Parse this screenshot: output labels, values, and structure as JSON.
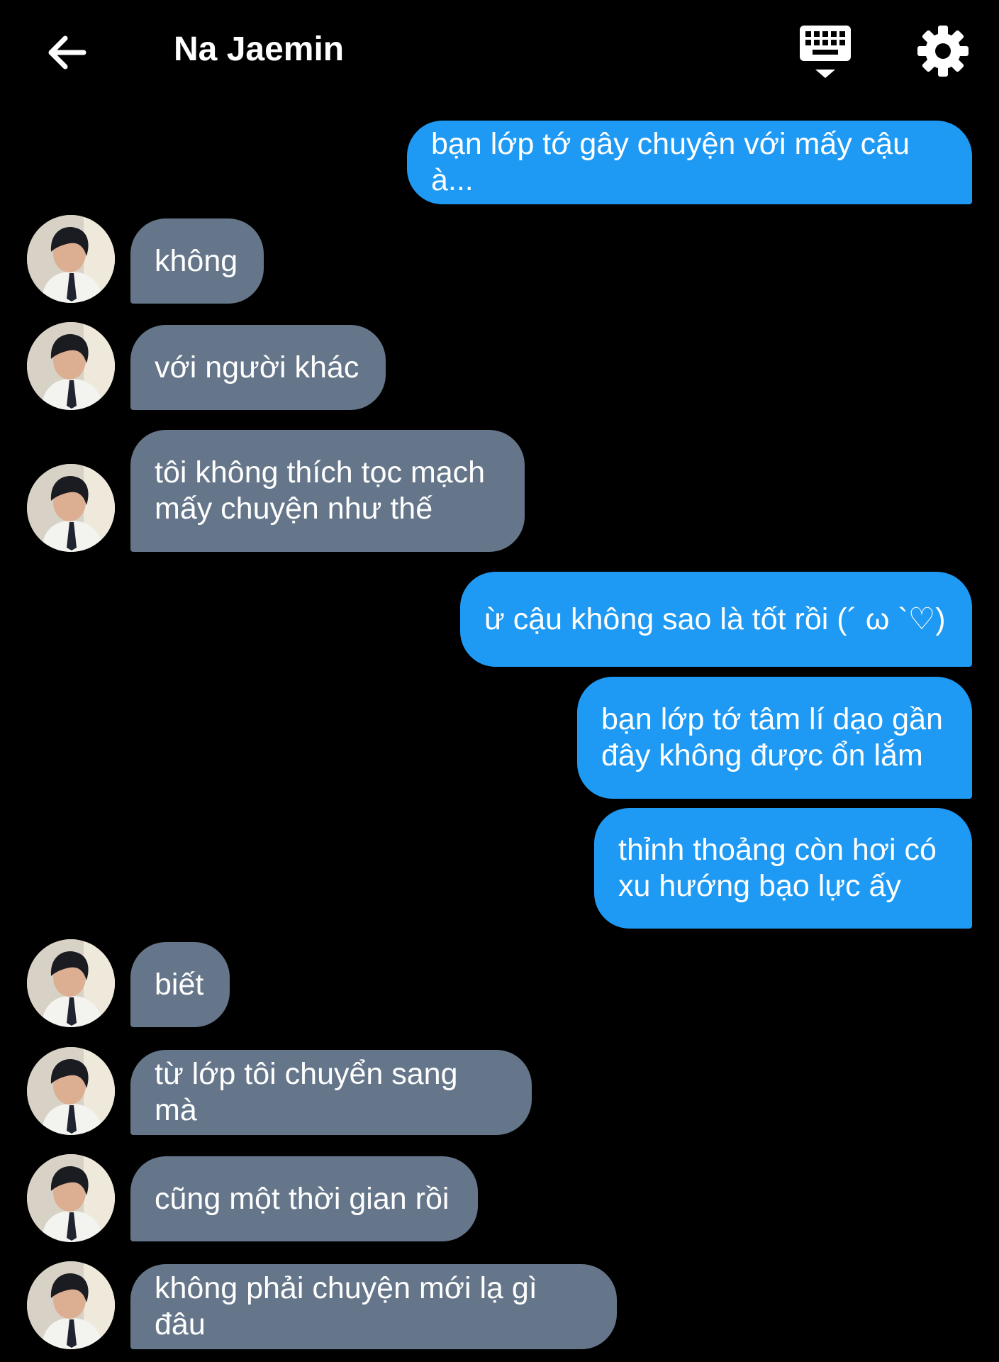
{
  "header": {
    "title": "Na Jaemin",
    "back_icon": "arrow-left-icon",
    "keyboard_icon": "keyboard-hide-icon",
    "settings_icon": "gear-icon"
  },
  "colors": {
    "background": "#000000",
    "sent_bubble": "#1e9af5",
    "received_bubble": "#65768a",
    "text": "#ffffff"
  },
  "messages": [
    {
      "from": "me",
      "text": "bạn lớp tớ gây chuyện với mấy cậu à..."
    },
    {
      "from": "them",
      "text": "không"
    },
    {
      "from": "them",
      "text": "với người khác"
    },
    {
      "from": "them",
      "text": "tôi không thích tọc mạch\nmấy chuyện như thế"
    },
    {
      "from": "me",
      "text": "ừ cậu không sao là tốt rồi (´ ω `♡)"
    },
    {
      "from": "me",
      "text": "bạn lớp tớ tâm lí dạo gần\nđây không được ổn lắm"
    },
    {
      "from": "me",
      "text": "thỉnh thoảng còn hơi có\nxu hướng bạo lực ấy"
    },
    {
      "from": "them",
      "text": "biết"
    },
    {
      "from": "them",
      "text": "từ lớp tôi chuyển sang mà"
    },
    {
      "from": "them",
      "text": "cũng một thời gian rồi"
    },
    {
      "from": "them",
      "text": "không phải chuyện mới lạ gì đâu"
    }
  ]
}
